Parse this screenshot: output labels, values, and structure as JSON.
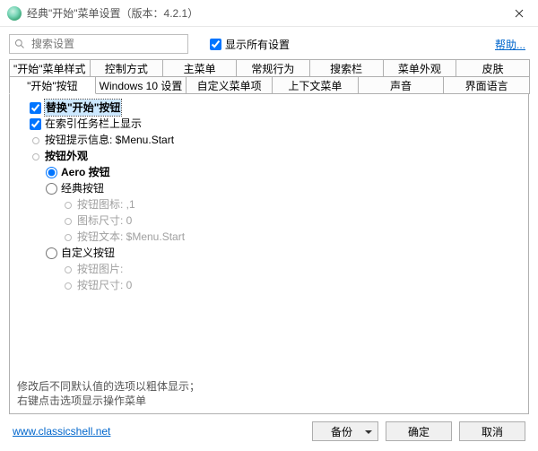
{
  "window": {
    "title": "经典\"开始\"菜单设置（版本：4.2.1）"
  },
  "toolbar": {
    "search_placeholder": "搜索设置",
    "show_all_label": "显示所有设置",
    "help_label": "帮助..."
  },
  "tabs_row1": [
    "\"开始\"菜单样式",
    "控制方式",
    "主菜单",
    "常规行为",
    "搜索栏",
    "菜单外观",
    "皮肤"
  ],
  "tabs_row2": [
    "\"开始\"按钮",
    "Windows 10 设置",
    "自定义菜单项",
    "上下文菜单",
    "声音",
    "界面语言"
  ],
  "active_tab": "\"开始\"按钮",
  "tree": {
    "replace_start": "替换\"开始\"按钮",
    "show_taskbar": "在索引任务栏上显示",
    "tooltip": "按钮提示信息: $Menu.Start",
    "appearance_header": "按钮外观",
    "opt_aero": "Aero 按钮",
    "opt_classic": "经典按钮",
    "classic_icon": "按钮图标: ,1",
    "classic_iconsize": "图标尺寸: 0",
    "classic_text": "按钮文本: $Menu.Start",
    "opt_custom": "自定义按钮",
    "custom_image": "按钮图片:",
    "custom_size": "按钮尺寸: 0"
  },
  "note": {
    "line1": "修改后不同默认值的选项以粗体显示；",
    "line2": "右键点击选项显示操作菜单"
  },
  "footer": {
    "url": "www.classicshell.net",
    "backup": "备份",
    "ok": "确定",
    "cancel": "取消"
  }
}
